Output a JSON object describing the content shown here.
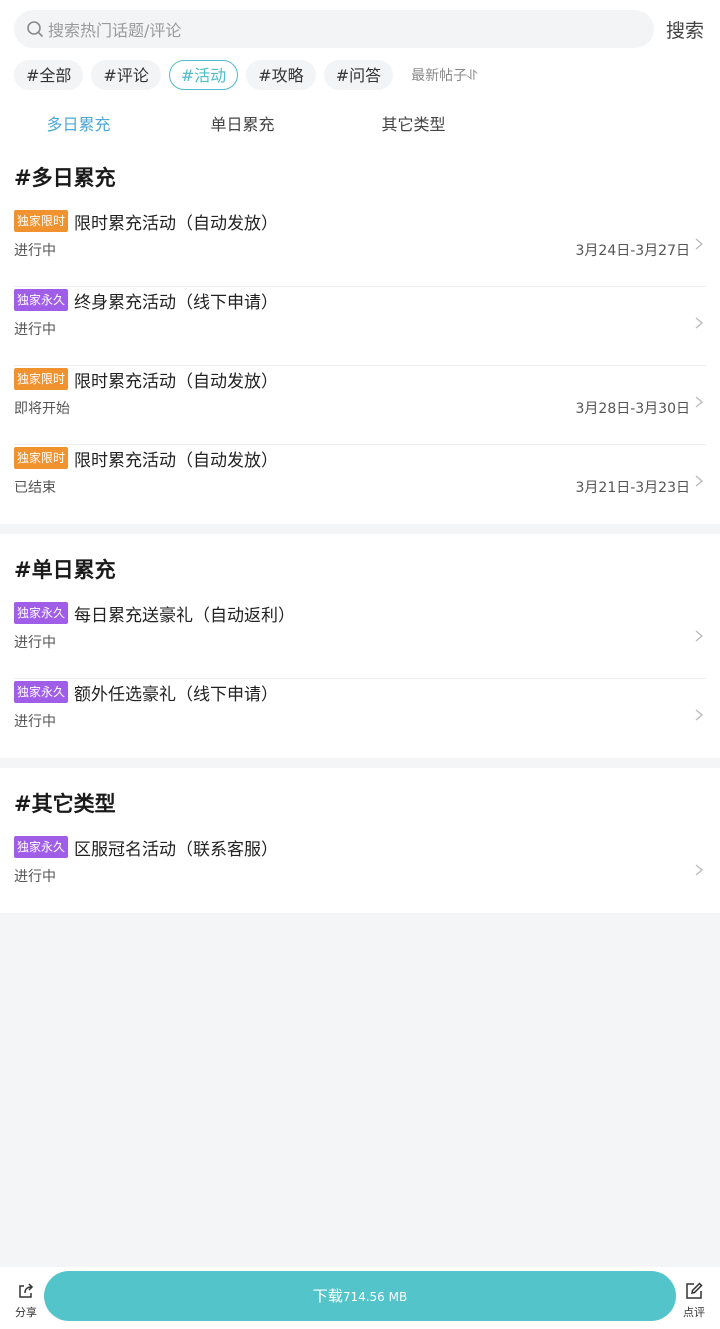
{
  "search": {
    "placeholder": "搜索热门话题/评论",
    "button": "搜索"
  },
  "tags": [
    "#全部",
    "#评论",
    "#活动",
    "#攻略",
    "#问答"
  ],
  "active_tag_index": 2,
  "sort_label": "最新帖子⥯",
  "subtabs": [
    "多日累充",
    "单日累充",
    "其它类型"
  ],
  "sections": [
    {
      "title": "#多日累充",
      "items": [
        {
          "badge": "独家限时",
          "badge_color": "#f0922e",
          "title": "限时累充活动（自动发放）",
          "status": "进行中",
          "date": "3月24日-3月27日"
        },
        {
          "badge": "独家永久",
          "badge_color": "#a05ee8",
          "title": "终身累充活动（线下申请）",
          "status": "进行中",
          "date": ""
        },
        {
          "badge": "独家限时",
          "badge_color": "#f0922e",
          "title": "限时累充活动（自动发放）",
          "status": "即将开始",
          "date": "3月28日-3月30日"
        },
        {
          "badge": "独家限时",
          "badge_color": "#f0922e",
          "title": "限时累充活动（自动发放）",
          "status": "已结束",
          "date": "3月21日-3月23日"
        }
      ]
    },
    {
      "title": "#单日累充",
      "items": [
        {
          "badge": "独家永久",
          "badge_color": "#a05ee8",
          "title": "每日累充送豪礼（自动返利）",
          "status": "进行中",
          "date": ""
        },
        {
          "badge": "独家永久",
          "badge_color": "#a05ee8",
          "title": "额外任选豪礼（线下申请）",
          "status": "进行中",
          "date": ""
        }
      ]
    },
    {
      "title": "#其它类型",
      "items": [
        {
          "badge": "独家永久",
          "badge_color": "#a05ee8",
          "title": "区服冠名活动（联系客服）",
          "status": "进行中",
          "date": ""
        }
      ]
    }
  ],
  "bottom": {
    "share_label": "分享",
    "download_label": "下载",
    "download_size": "714.56 MB",
    "comment_label": "点评"
  }
}
